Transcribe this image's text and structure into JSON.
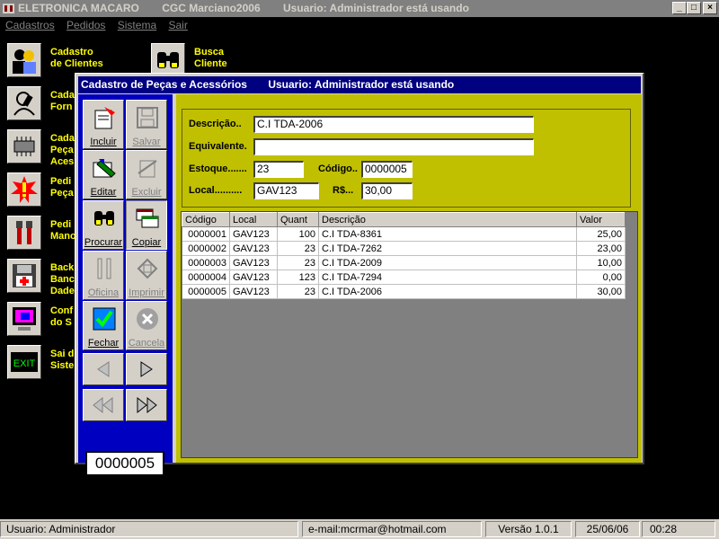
{
  "window": {
    "title_parts": [
      "ELETRONICA MACARO",
      "CGC Marciano2006",
      "Usuario: Administrador  está usando"
    ],
    "controls": [
      "_",
      "□",
      "×"
    ]
  },
  "menu": [
    "Cadastros",
    "Pedidos",
    "Sistema",
    "Sair"
  ],
  "shortcuts": [
    {
      "label": "Cadastro\nde Clientes",
      "icon": "people-icon"
    },
    {
      "label": "Busca\nCliente",
      "icon": "binoculars-icon"
    },
    {
      "label": "Cada\nForn",
      "icon": "phone-person-icon"
    },
    {
      "label": "Cada\nPeça\nAces",
      "icon": "chip-icon"
    },
    {
      "label": "Pedi\nPeça",
      "icon": "alert-icon"
    },
    {
      "label": "Pedi\nMano",
      "icon": "tools-icon"
    },
    {
      "label": "Back\nBanc\nDade",
      "icon": "floppy-icon"
    },
    {
      "label": "Conf\ndo S",
      "icon": "monitor-icon"
    },
    {
      "label": "Sai d\nSiste",
      "icon": "exit-icon"
    }
  ],
  "dialog": {
    "title": "Cadastro de Peças e Acessórios",
    "user": "Usuario: Administrador  está usando",
    "buttons": {
      "incluir": "Incluir",
      "salvar": "Salvar",
      "editar": "Editar",
      "excluir": "Excluir",
      "procurar": "Procurar",
      "copiar": "Copiar",
      "oficina": "Oficina",
      "imprimir": "Imprimir",
      "fechar": "Fechar",
      "cancela": "Cancela"
    },
    "counter": "0000005",
    "form": {
      "descricao_label": "Descrição..",
      "descricao_value": "C.I TDA-2006",
      "equivalente_label": "Equivalente.",
      "equivalente_value": "",
      "estoque_label": "Estoque.......",
      "estoque_value": "23",
      "codigo_label": "Código..",
      "codigo_value": "0000005",
      "local_label": "Local..........",
      "local_value": "GAV123",
      "rs_label": "R$...",
      "rs_value": "30,00"
    },
    "grid": {
      "columns": [
        "Código",
        "Local",
        "Quant",
        "Descrição",
        "Valor"
      ],
      "rows": [
        [
          "0000001",
          "GAV123",
          "100",
          "C.I TDA-8361",
          "25,00"
        ],
        [
          "0000002",
          "GAV123",
          "23",
          "C.I TDA-7262",
          "23,00"
        ],
        [
          "0000003",
          "GAV123",
          "23",
          "C.I TDA-2009",
          "10,00"
        ],
        [
          "0000004",
          "GAV123",
          "123",
          "C.I TDA-7294",
          "0,00"
        ],
        [
          "0000005",
          "GAV123",
          "23",
          "C.I TDA-2006",
          "30,00"
        ]
      ]
    }
  },
  "status": {
    "user": "Usuario: Administrador",
    "email": "e-mail:mcrmar@hotmail.com",
    "version": "Versão 1.0.1",
    "date": "25/06/06",
    "time": "00:28"
  }
}
